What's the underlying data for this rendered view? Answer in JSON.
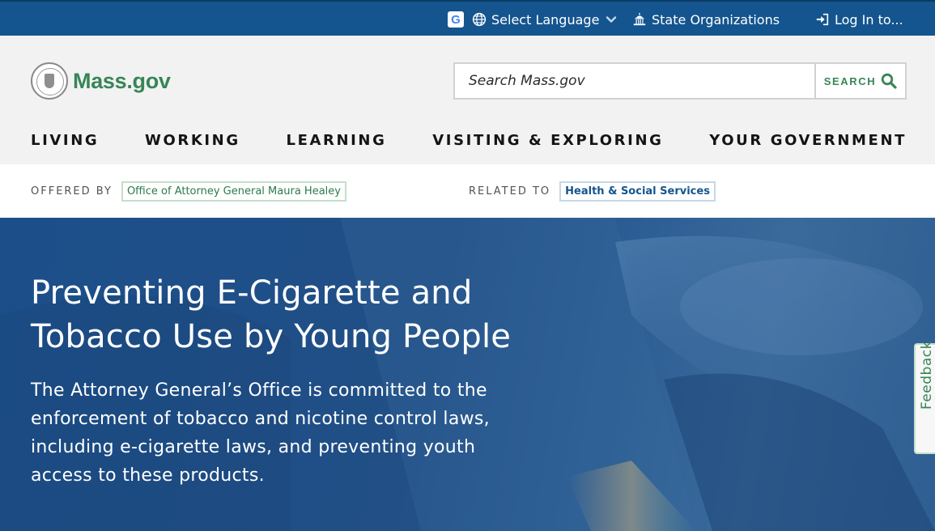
{
  "utility_bar": {
    "language_label": "Select Language",
    "organizations_label": "State Organizations",
    "login_label": "Log In to...",
    "background_color": "#14558f"
  },
  "header": {
    "logo_text": "Mass.gov",
    "search_placeholder": "Search Mass.gov",
    "search_button_label": "SEARCH",
    "nav": [
      "LIVING",
      "WORKING",
      "LEARNING",
      "VISITING & EXPLORING",
      "YOUR GOVERNMENT"
    ],
    "accent_color": "#388557"
  },
  "meta": {
    "offered_by_label": "OFFERED BY",
    "offered_by_org": "Office of Attorney General Maura Healey",
    "related_to_label": "RELATED TO",
    "related_to_topic": "Health & Social Services"
  },
  "hero": {
    "title": "Preventing E-Cigarette and Tobacco Use by Young People",
    "lede": "The Attorney General’s Office is committed to the enforcement of tobacco and nicotine control laws, including e-cigarette laws, and preventing youth access to these products."
  },
  "feedback": {
    "label": "Feedback"
  },
  "icons": {
    "google_translate": "google-g-icon",
    "globe": "globe-icon",
    "chevron": "chevron-down-icon",
    "building": "capitol-building-icon",
    "login": "login-arrow-icon",
    "search": "magnifier-icon",
    "seal": "massachusetts-seal-icon"
  }
}
